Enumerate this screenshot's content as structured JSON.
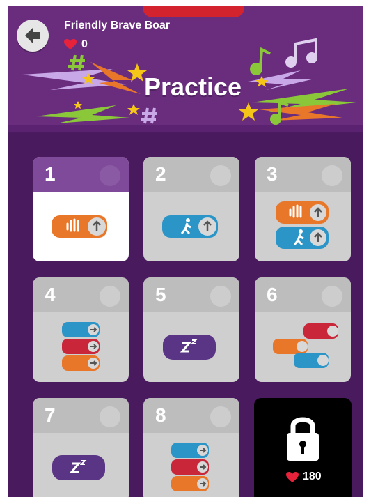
{
  "header": {
    "player_name": "Friendly Brave Boar",
    "hearts": "0",
    "title": "Practice"
  },
  "cards": [
    {
      "number": "1",
      "active": true,
      "blocks": [
        "hand-block"
      ]
    },
    {
      "number": "2",
      "active": false,
      "blocks": [
        "walk-block"
      ]
    },
    {
      "number": "3",
      "active": false,
      "blocks": [
        "hand-block",
        "walk-block"
      ]
    },
    {
      "number": "4",
      "active": false,
      "blocks": [
        "walk-block",
        "walk-block",
        "hand-block"
      ]
    },
    {
      "number": "5",
      "active": false,
      "blocks": [
        "sleep-block"
      ]
    },
    {
      "number": "6",
      "active": false,
      "blocks": [
        "walk-block",
        "hand-block",
        "walk-block"
      ]
    },
    {
      "number": "7",
      "active": false,
      "blocks": [
        "sleep-block"
      ]
    },
    {
      "number": "8",
      "active": false,
      "blocks": [
        "walk-block",
        "walk-block",
        "hand-block"
      ]
    }
  ],
  "locked_card": {
    "cost": "180",
    "icon": "lock-icon"
  },
  "colors": {
    "background": "#4a1a5e",
    "header": "#6a2d7e",
    "active_card_header": "#7f4a99",
    "hand_block": "#e8772a",
    "walk_block": "#2b95c8",
    "red_block": "#c9263a",
    "sleep_block": "#5a3585",
    "heart": "#e8223a"
  }
}
